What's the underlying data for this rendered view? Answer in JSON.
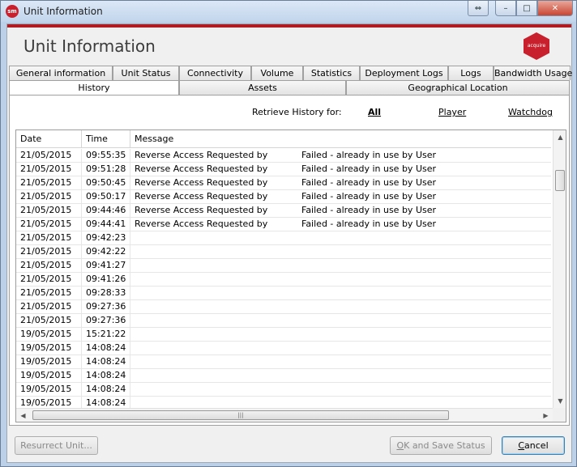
{
  "window": {
    "title": "Unit Information",
    "app_icon_text": "sm",
    "controls": {
      "restore_alt": "⇔",
      "minimize": "–",
      "maximize": "□",
      "close": "✕"
    }
  },
  "header": {
    "title": "Unit Information",
    "logo_text": "acquire"
  },
  "tabs_row1": [
    "General information",
    "Unit Status",
    "Connectivity",
    "Volume",
    "Statistics",
    "Deployment Logs",
    "Logs",
    "Bandwidth Usage"
  ],
  "tabs_row2": [
    "History",
    "Assets",
    "Geographical Location"
  ],
  "active_tab": "History",
  "retrieve": {
    "label": "Retrieve History for:",
    "options": [
      "All",
      "Player",
      "Watchdog"
    ],
    "selected": "All"
  },
  "grid": {
    "columns": [
      "Date",
      "Time",
      "Message"
    ],
    "rows": [
      {
        "date": "21/05/2015",
        "time": "09:55:35",
        "msg_a": "Reverse Access Requested by",
        "msg_b": "Failed - already in use by User"
      },
      {
        "date": "21/05/2015",
        "time": "09:51:28",
        "msg_a": "Reverse Access Requested by",
        "msg_b": "Failed - already in use by User"
      },
      {
        "date": "21/05/2015",
        "time": "09:50:45",
        "msg_a": "Reverse Access Requested by",
        "msg_b": "Failed - already in use by User"
      },
      {
        "date": "21/05/2015",
        "time": "09:50:17",
        "msg_a": "Reverse Access Requested by",
        "msg_b": "Failed - already in use by User"
      },
      {
        "date": "21/05/2015",
        "time": "09:44:46",
        "msg_a": "Reverse Access Requested by",
        "msg_b": "Failed - already in use by User"
      },
      {
        "date": "21/05/2015",
        "time": "09:44:41",
        "msg_a": "Reverse Access Requested by",
        "msg_b": "Failed - already in use by User"
      },
      {
        "date": "21/05/2015",
        "time": "09:42:23",
        "msg_a": "",
        "msg_b": ""
      },
      {
        "date": "21/05/2015",
        "time": "09:42:22",
        "msg_a": "",
        "msg_b": ""
      },
      {
        "date": "21/05/2015",
        "time": "09:41:27",
        "msg_a": "",
        "msg_b": ""
      },
      {
        "date": "21/05/2015",
        "time": "09:41:26",
        "msg_a": "",
        "msg_b": ""
      },
      {
        "date": "21/05/2015",
        "time": "09:28:33",
        "msg_a": "",
        "msg_b": ""
      },
      {
        "date": "21/05/2015",
        "time": "09:27:36",
        "msg_a": "",
        "msg_b": ""
      },
      {
        "date": "21/05/2015",
        "time": "09:27:36",
        "msg_a": "",
        "msg_b": ""
      },
      {
        "date": "19/05/2015",
        "time": "15:21:22",
        "msg_a": "",
        "msg_b": ""
      },
      {
        "date": "19/05/2015",
        "time": "14:08:24",
        "msg_a": "",
        "msg_b": ""
      },
      {
        "date": "19/05/2015",
        "time": "14:08:24",
        "msg_a": "",
        "msg_b": ""
      },
      {
        "date": "19/05/2015",
        "time": "14:08:24",
        "msg_a": "",
        "msg_b": ""
      },
      {
        "date": "19/05/2015",
        "time": "14:08:24",
        "msg_a": "",
        "msg_b": ""
      },
      {
        "date": "19/05/2015",
        "time": "14:08:24",
        "msg_a": "",
        "msg_b": ""
      }
    ]
  },
  "footer": {
    "resurrect_label": "Resurrect Unit...",
    "ok_label_u": "O",
    "ok_label_rest": "K and Save Status",
    "cancel_label_u": "C",
    "cancel_label_rest": "ancel"
  },
  "colors": {
    "accent_red": "#b11c22",
    "logo_red": "#c8202c"
  }
}
